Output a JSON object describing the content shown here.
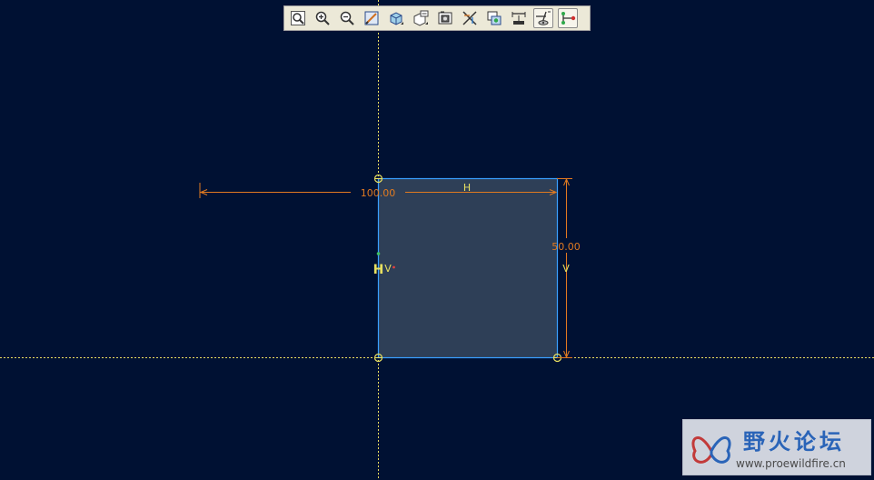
{
  "toolbar": {
    "buttons": [
      {
        "name": "refit-icon",
        "active": false
      },
      {
        "name": "zoom-in-icon",
        "active": false
      },
      {
        "name": "zoom-out-icon",
        "active": false
      },
      {
        "name": "repaint-icon",
        "active": false
      },
      {
        "name": "display-style-icon",
        "active": false
      },
      {
        "name": "saved-view-icon",
        "active": false
      },
      {
        "name": "sketch-view-icon",
        "active": false
      },
      {
        "name": "disp-constraints-icon",
        "active": false
      },
      {
        "name": "disp-vertices-icon",
        "active": false
      },
      {
        "name": "disp-dimensions-icon",
        "active": false
      },
      {
        "name": "disp-grid-icon",
        "active": true
      },
      {
        "name": "disp-entities-icon",
        "active": true
      }
    ]
  },
  "sketch": {
    "width_dimension": "100.00",
    "height_dimension": "50.00",
    "horizontal_constraint": "H",
    "vertical_constraint_right": "V",
    "vertical_constraint_left": "V",
    "left_symbol": "H"
  },
  "watermark": {
    "title": "野火论坛",
    "url": "www.proewildfire.cn"
  },
  "colors": {
    "background": "#001133",
    "centerline": "#e8e060",
    "dimension": "#e07a20",
    "sketch_edge": "#3aa0ff",
    "fill": "#2e3f57"
  }
}
